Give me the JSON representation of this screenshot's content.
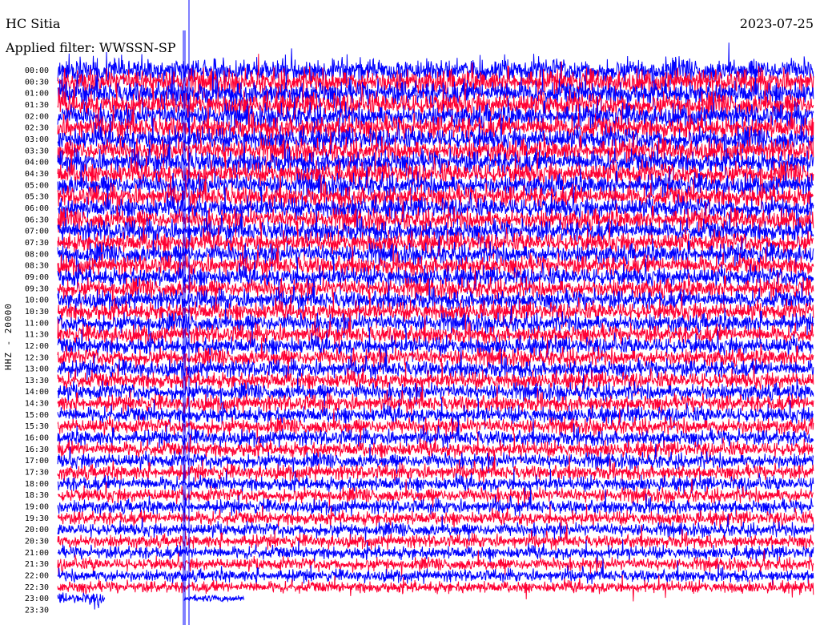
{
  "header": {
    "station": "HC Sitia",
    "date": "2023-07-25",
    "filter_label": "Applied filter: WWSSN-SP"
  },
  "chart_data": {
    "type": "line",
    "title": "HC Sitia",
    "subtitle": "Applied filter: WWSSN-SP",
    "ylabel": "HHZ - 20000",
    "xlabel": "",
    "rows": [
      "00:00",
      "00:30",
      "01:00",
      "01:30",
      "02:00",
      "02:30",
      "03:00",
      "03:30",
      "04:00",
      "04:30",
      "05:00",
      "05:30",
      "06:00",
      "06:30",
      "07:00",
      "07:30",
      "08:00",
      "08:30",
      "09:00",
      "09:30",
      "10:00",
      "10:30",
      "11:00",
      "11:30",
      "12:00",
      "12:30",
      "13:00",
      "13:30",
      "14:00",
      "14:30",
      "15:00",
      "15:30",
      "16:00",
      "16:30",
      "17:00",
      "17:30",
      "18:00",
      "18:30",
      "19:00",
      "19:30",
      "20:00",
      "20:30",
      "21:00",
      "21:30",
      "22:00",
      "22:30",
      "23:00",
      "23:30"
    ],
    "colors": [
      "#0000ff",
      "#ff0033"
    ],
    "colors_alternate": true,
    "data_end_fraction_last_row": 0.25
  }
}
